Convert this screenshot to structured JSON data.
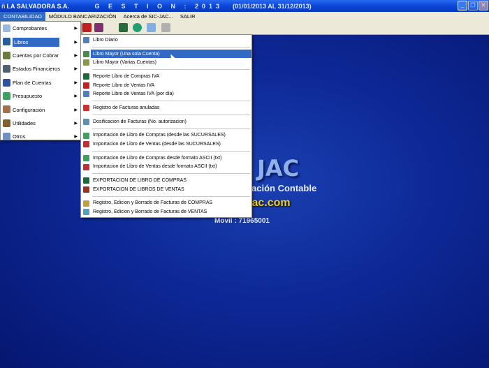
{
  "window": {
    "app_name": "LA SALVADORA S.A.",
    "gestion": "G E S T I O N : 2013",
    "period": "(01/01/2013  AL  31/12/2013)",
    "controls": [
      "_",
      "❐",
      "✕"
    ]
  },
  "menubar": [
    "CONTABILIDAD",
    "MÓDULO BANCARIZACIÓN",
    "Acerca de SIC-JAC...",
    "SALIR"
  ],
  "main_menu": [
    {
      "label": "Comprobantes",
      "color": "#9ab8e0"
    },
    {
      "label": "Libros",
      "color": "#2a5a9a",
      "highlighted": true
    },
    {
      "label": "Cuentas por Cobrar",
      "color": "#6a7a40"
    },
    {
      "label": "Estados Financieros",
      "color": "#506070"
    },
    {
      "label": "Plan de Cuentas",
      "color": "#3050a0"
    },
    {
      "label": "Presupuesto",
      "color": "#40a060"
    },
    {
      "label": "Configuración",
      "color": "#a07050"
    },
    {
      "label": "Utilidades",
      "color": "#806030"
    },
    {
      "label": "Otros",
      "color": "#7090c0"
    }
  ],
  "submenu": [
    [
      {
        "label": "Libro Diario",
        "color": "#5080c0"
      }
    ],
    [
      {
        "label": "Libro Mayor (Una sola Cuenta)",
        "color": "#4a8a4a",
        "highlighted": true
      },
      {
        "label": "Libro Mayor (Varias Cuentas)",
        "color": "#8a9a40"
      }
    ],
    [
      {
        "label": "Reporte Libro de Compras IVA",
        "color": "#1a6a3a"
      },
      {
        "label": "Reporte Libro de Ventas IVA",
        "color": "#c02020"
      },
      {
        "label": "Reporte Libro de Ventas IVA (por dia)",
        "color": "#5080c0"
      }
    ],
    [
      {
        "label": "Registro de Facturas anuladas",
        "color": "#d03030"
      }
    ],
    [
      {
        "label": "Dosificacion de Facturas (No. autorizacion)",
        "color": "#6090b0"
      }
    ],
    [
      {
        "label": "Importacion de Libro de Compras (desde las SUCURSALES)",
        "color": "#40a060"
      },
      {
        "label": "Importacion de Libro de Ventas (desde las SUCURSALES)",
        "color": "#c03030"
      }
    ],
    [
      {
        "label": "Importacion de Libro de Compras desde formato ASCII (txt)",
        "color": "#40a060"
      },
      {
        "label": "Importacion de Libro de Ventas desde formato ASCII (txt)",
        "color": "#c03030"
      }
    ],
    [
      {
        "label": "EXPORTACION DE LIBRO DE COMPRAS",
        "color": "#1a6a3a"
      },
      {
        "label": "EXPORTACION DE LIBROS DE VENTAS",
        "color": "#a03020"
      }
    ],
    [
      {
        "label": "Registro, Edicion y Borrado de Facturas de COMPRAS",
        "color": "#c0a040"
      },
      {
        "label": "Registro, Edicion y Borrado de Facturas de VENTAS",
        "color": "#50a0c0"
      }
    ]
  ],
  "background": {
    "logo": "JAC",
    "subtitle": "ación Contable",
    "web": "iac.com",
    "phone": "Movil : 71965001"
  }
}
